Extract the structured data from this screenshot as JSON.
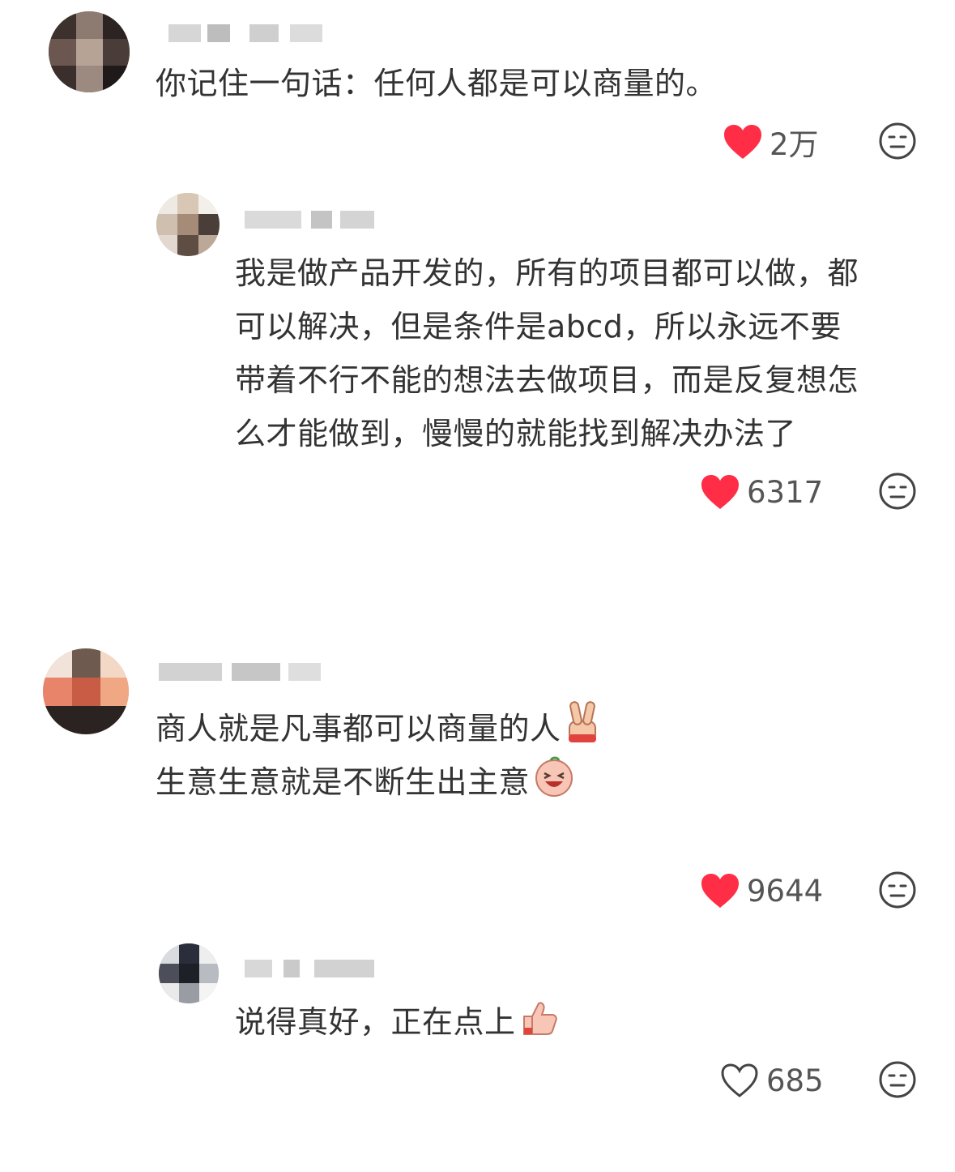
{
  "colors": {
    "liked_heart": "#ff2d45",
    "text": "#333333",
    "muted": "#555555",
    "icon_stroke": "#444444"
  },
  "comments": [
    {
      "text_lines": [
        "你记住一句话：任何人都是可以商量的。"
      ],
      "likes": "2万",
      "liked": true
    },
    {
      "text_lines": [
        "我是做产品开发的，所有的项目都可以做，都",
        "可以解决，但是条件是abcd，所以永远不要",
        "带着不行不能的想法去做项目，而是反复想怎",
        "么才能做到，慢慢的就能找到解决办法了"
      ],
      "likes": "6317",
      "liked": true
    },
    {
      "text_lines": [
        "商人就是凡事都可以商量的人",
        "生意生意就是不断生出主意"
      ],
      "emojis": [
        "victory-hand-emoji",
        "laughing-peach-emoji"
      ],
      "likes": "9644",
      "liked": true
    },
    {
      "text_lines": [
        "说得真好，正在点上"
      ],
      "emojis": [
        "thumbs-up-emoji"
      ],
      "likes": "685",
      "liked": false
    }
  ]
}
